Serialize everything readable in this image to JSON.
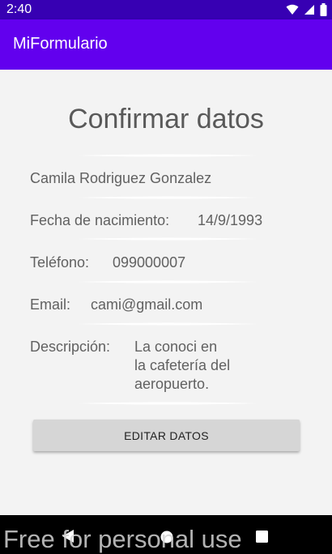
{
  "status_bar": {
    "time": "2:40",
    "icons": [
      "wifi-icon",
      "signal-icon",
      "battery-icon"
    ]
  },
  "app_bar": {
    "title": "MiFormulario"
  },
  "form": {
    "title": "Confirmar datos",
    "name": "Camila Rodriguez Gonzalez",
    "birth_label": "Fecha de nacimiento:",
    "birth_value": "14/9/1993",
    "phone_label": "Teléfono:",
    "phone_value": "099000007",
    "email_label": "Email:",
    "email_value": "cami@gmail.com",
    "description_label": "Descripción:",
    "description_lines": [
      "La conoci en",
      "la cafetería del",
      "aeropuerto."
    ],
    "edit_button": "EDITAR DATOS"
  },
  "nav_bar": {
    "icons": [
      "back-icon",
      "home-icon",
      "recents-icon"
    ]
  },
  "watermark": "Free for personal use",
  "colors": {
    "status_bar": "#3700b3",
    "app_bar": "#6200ee",
    "background": "#f3f3f3",
    "text": "#616161",
    "button": "#d6d6d6"
  }
}
